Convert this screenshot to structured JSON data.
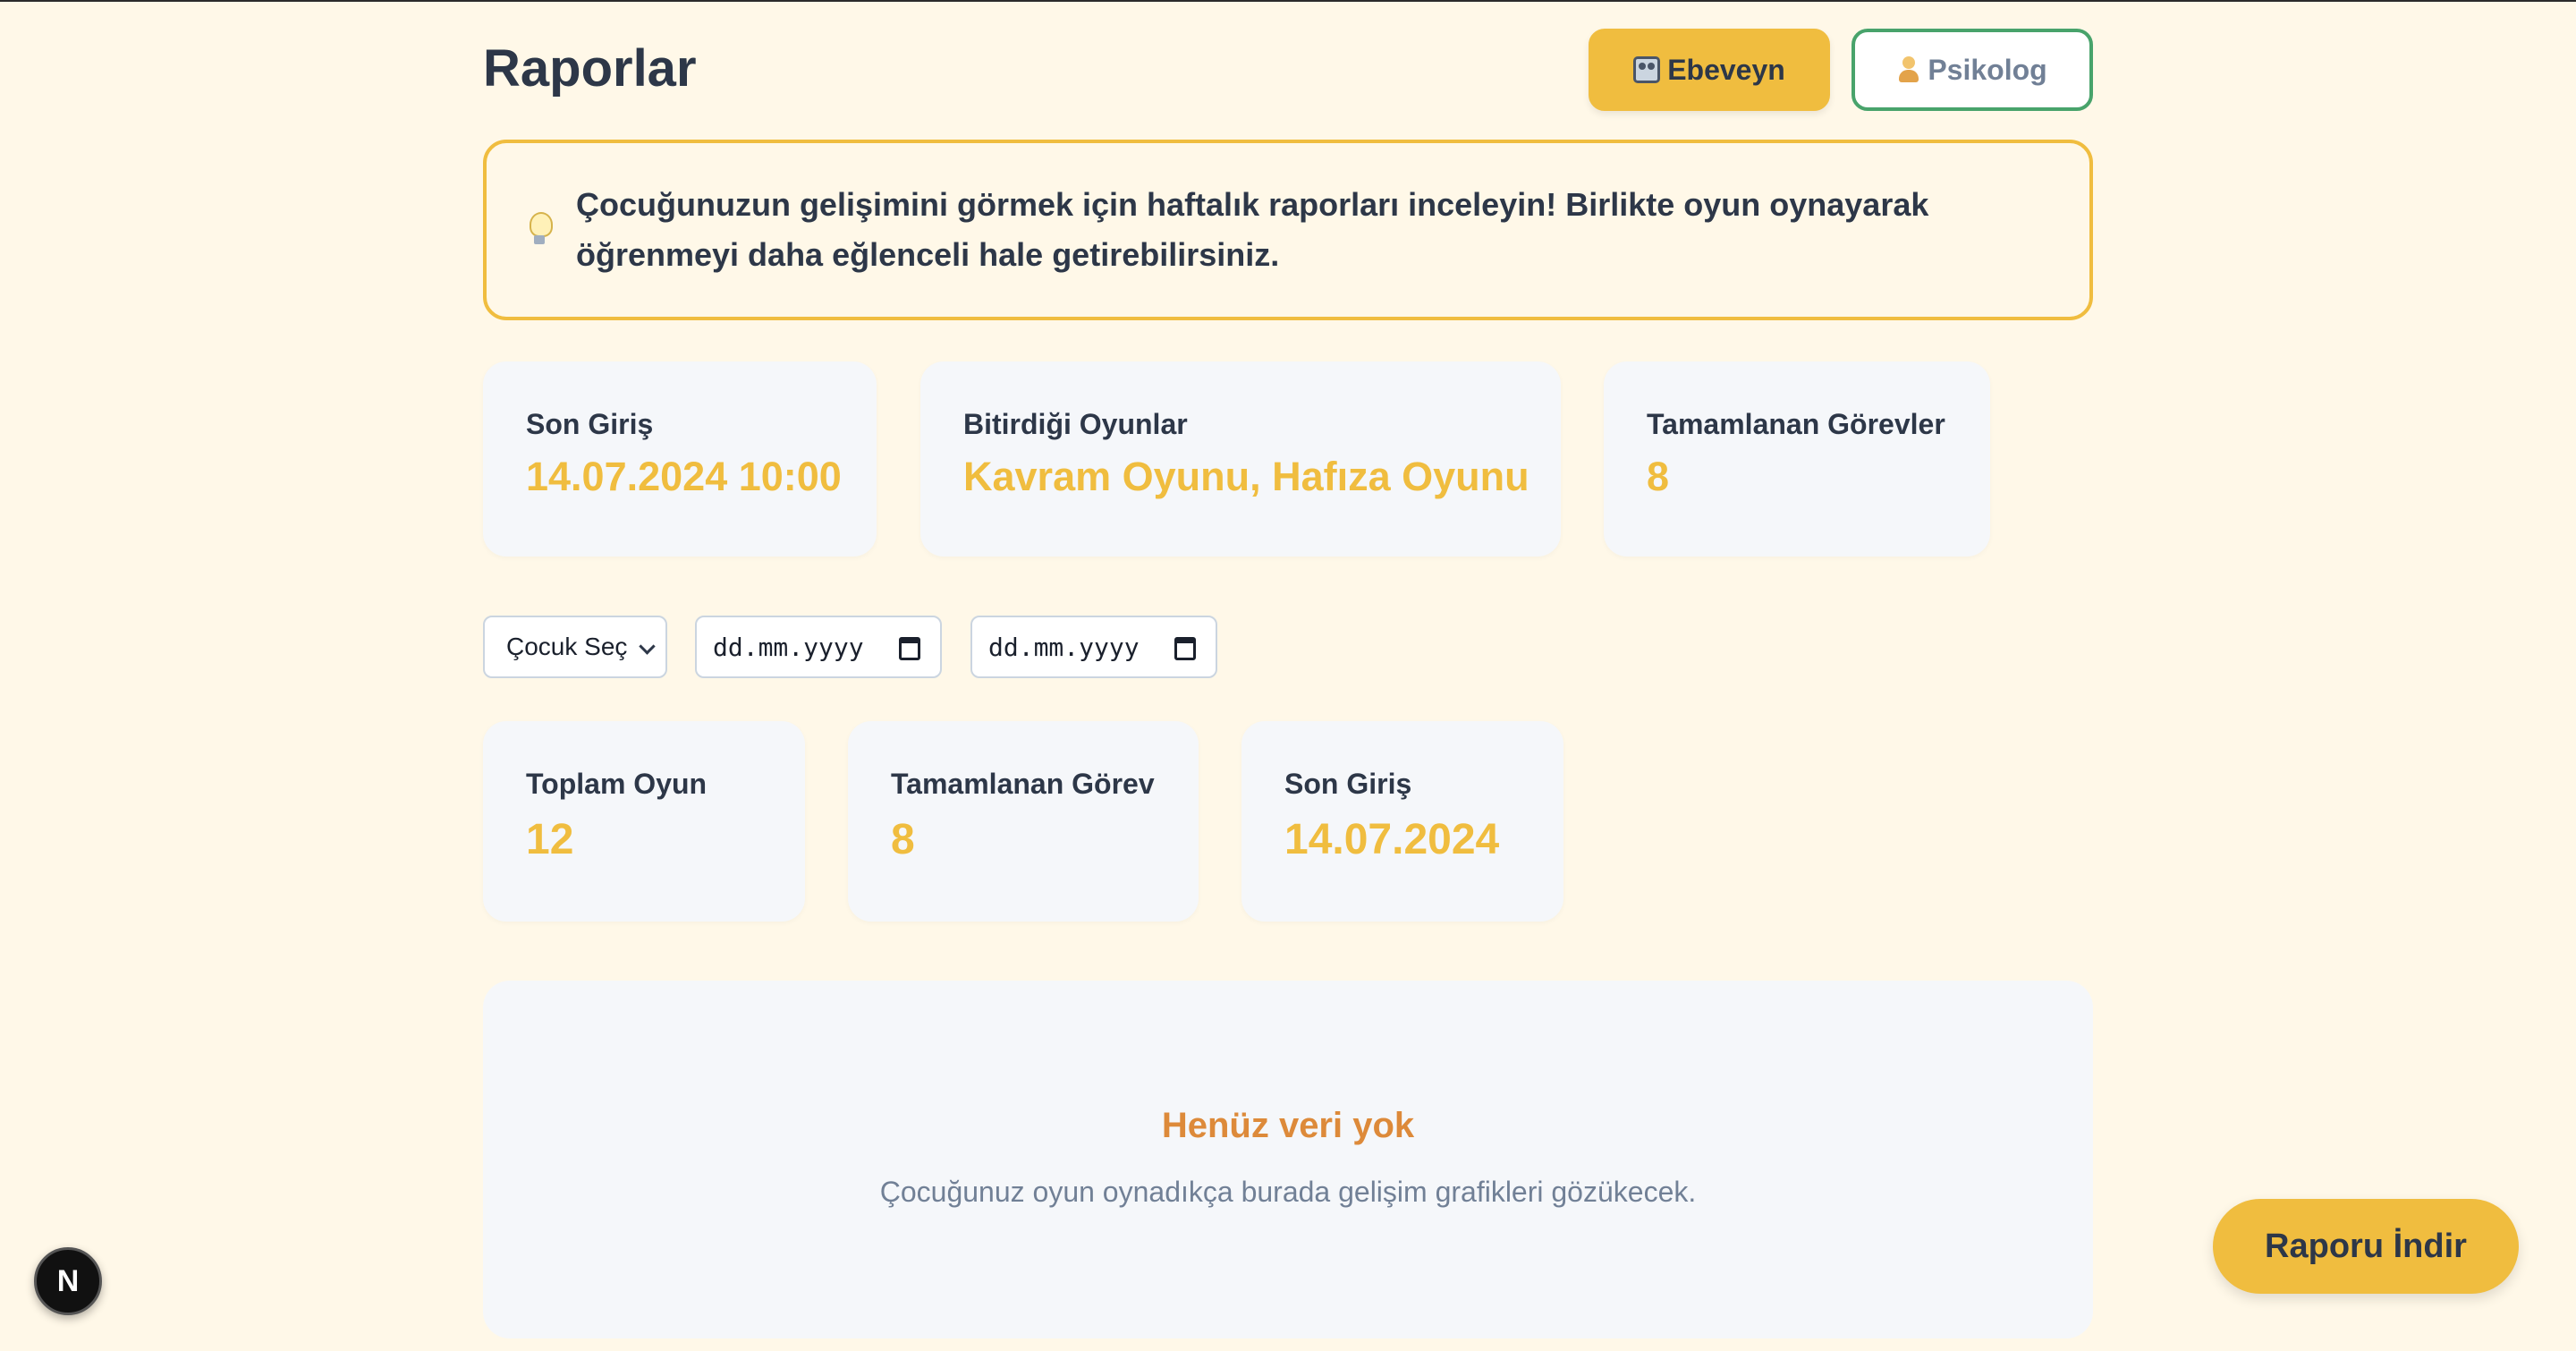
{
  "header": {
    "title": "Raporlar",
    "parent_button": "Ebeveyn",
    "psychologist_button": "Psikolog",
    "parent_icon": "family-icon",
    "psychologist_icon": "psychologist-icon"
  },
  "tip": {
    "icon": "lightbulb-icon",
    "text": "Çocuğunuzun gelişimini görmek için haftalık raporları inceleyin! Birlikte oyun oynayarak öğrenmeyi daha eğlenceli hale getirebilirsiniz."
  },
  "summary_cards": [
    {
      "label": "Son Giriş",
      "value": "14.07.2024 10:00"
    },
    {
      "label": "Bitirdiği Oyunlar",
      "value": "Kavram Oyunu, Hafıza Oyunu"
    },
    {
      "label": "Tamamlanan Görevler",
      "value": "8"
    }
  ],
  "filters": {
    "child_select": "Çocuk Seç",
    "start_date_placeholder": "dd.mm.yyyy",
    "end_date_placeholder": "dd.mm.yyyy"
  },
  "stats_cards": [
    {
      "label": "Toplam Oyun",
      "value": "12"
    },
    {
      "label": "Tamamlanan Görev",
      "value": "8"
    },
    {
      "label": "Son Giriş",
      "value": "14.07.2024"
    }
  ],
  "empty_state": {
    "title": "Henüz veri yok",
    "subtitle": "Çocuğunuz oyun oynadıkça burada gelişim grafikleri gözükecek."
  },
  "download_button": "Raporu İndir",
  "dev_badge": "N",
  "colors": {
    "background": "#FFF8E8",
    "accent": "#F0BD3F",
    "psych_border": "#48A36B",
    "empty_title": "#DD8A3A",
    "card_bg": "#F5F7FA"
  }
}
